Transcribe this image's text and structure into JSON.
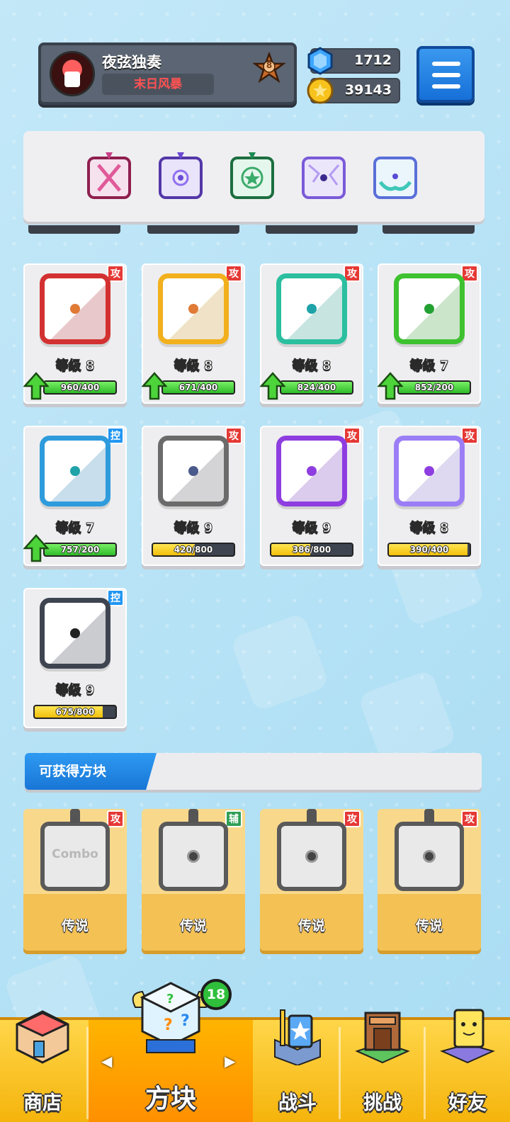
{
  "player": {
    "name": "夜弦独奏",
    "title": "末日风暴",
    "rank": "8"
  },
  "currency": {
    "gems": "1712",
    "coins": "39143"
  },
  "colors": {
    "attack_tag": "#e53935",
    "control_tag": "#2196f3",
    "support_tag": "#2e9e54",
    "legend_card": "#f4c154",
    "nav_bar": "#f5b40c",
    "menu_button": "#1670d8"
  },
  "element_slots": [
    {
      "icon": "pink-dragon-element-icon"
    },
    {
      "icon": "purple-dragon-element-icon"
    },
    {
      "icon": "green-dragon-element-icon"
    },
    {
      "icon": "purple-crack-element-icon"
    },
    {
      "icon": "teal-hands-element-icon"
    }
  ],
  "owned_blocks": [
    {
      "tag": "攻",
      "level": "等级 8",
      "progress": "960/400",
      "fill_pct": 100,
      "color": "#d33131",
      "dot": "#e07a35",
      "bar": "green",
      "upgrade": true,
      "icon": "fire-die-icon"
    },
    {
      "tag": "攻",
      "level": "等级 8",
      "progress": "671/400",
      "fill_pct": 100,
      "color": "#f2b01d",
      "dot": "#e07a35",
      "bar": "green",
      "upgrade": true,
      "icon": "electric-die-icon"
    },
    {
      "tag": "攻",
      "level": "等级 8",
      "progress": "824/400",
      "fill_pct": 100,
      "color": "#2bbf9f",
      "dot": "#1fa3a8",
      "bar": "green",
      "upgrade": true,
      "icon": "wind-die-icon"
    },
    {
      "tag": "攻",
      "level": "等级 7",
      "progress": "852/200",
      "fill_pct": 100,
      "color": "#3ec230",
      "dot": "#23a032",
      "bar": "green",
      "upgrade": true,
      "icon": "poison-die-icon"
    },
    {
      "tag": "控",
      "level": "等级 7",
      "progress": "757/200",
      "fill_pct": 100,
      "color": "#2e9bdc",
      "dot": "#1fa3a8",
      "bar": "green",
      "upgrade": true,
      "icon": "ice-die-icon"
    },
    {
      "tag": "攻",
      "level": "等级 9",
      "progress": "420/800",
      "fill_pct": 52,
      "color": "#6b6b6b",
      "dot": "#4a5a8a",
      "bar": "yellow",
      "upgrade": false,
      "icon": "gear-die-icon"
    },
    {
      "tag": "攻",
      "level": "等级 9",
      "progress": "386/800",
      "fill_pct": 48,
      "color": "#8e3ee0",
      "dot": "#8e3ee0",
      "bar": "yellow",
      "upgrade": false,
      "icon": "arrows-die-icon"
    },
    {
      "tag": "攻",
      "level": "等级 8",
      "progress": "390/400",
      "fill_pct": 97,
      "color": "#9b7ef5",
      "dot": "#8e3ee0",
      "bar": "yellow",
      "upgrade": false,
      "icon": "mystery-die-icon"
    },
    {
      "tag": "控",
      "level": "等级 9",
      "progress": "675/800",
      "fill_pct": 84,
      "color": "#3e4450",
      "dot": "#222222",
      "bar": "yellow",
      "upgrade": false,
      "icon": "lock-die-icon"
    }
  ],
  "obtainable": {
    "header": "可获得方块",
    "items": [
      {
        "tag": "攻",
        "rarity": "传说",
        "icon": "combo-die-icon",
        "face": "Combo"
      },
      {
        "tag": "辅",
        "rarity": "传说",
        "icon": "moon-die-icon",
        "face": ""
      },
      {
        "tag": "攻",
        "rarity": "传说",
        "icon": "star-die-icon",
        "face": ""
      },
      {
        "tag": "攻",
        "rarity": "传说",
        "icon": "blackhole-die-icon",
        "face": ""
      }
    ]
  },
  "nav": {
    "shop": "商店",
    "blocks": "方块",
    "blocks_badge": "18",
    "battle": "战斗",
    "challenge": "挑战",
    "friends": "好友"
  }
}
